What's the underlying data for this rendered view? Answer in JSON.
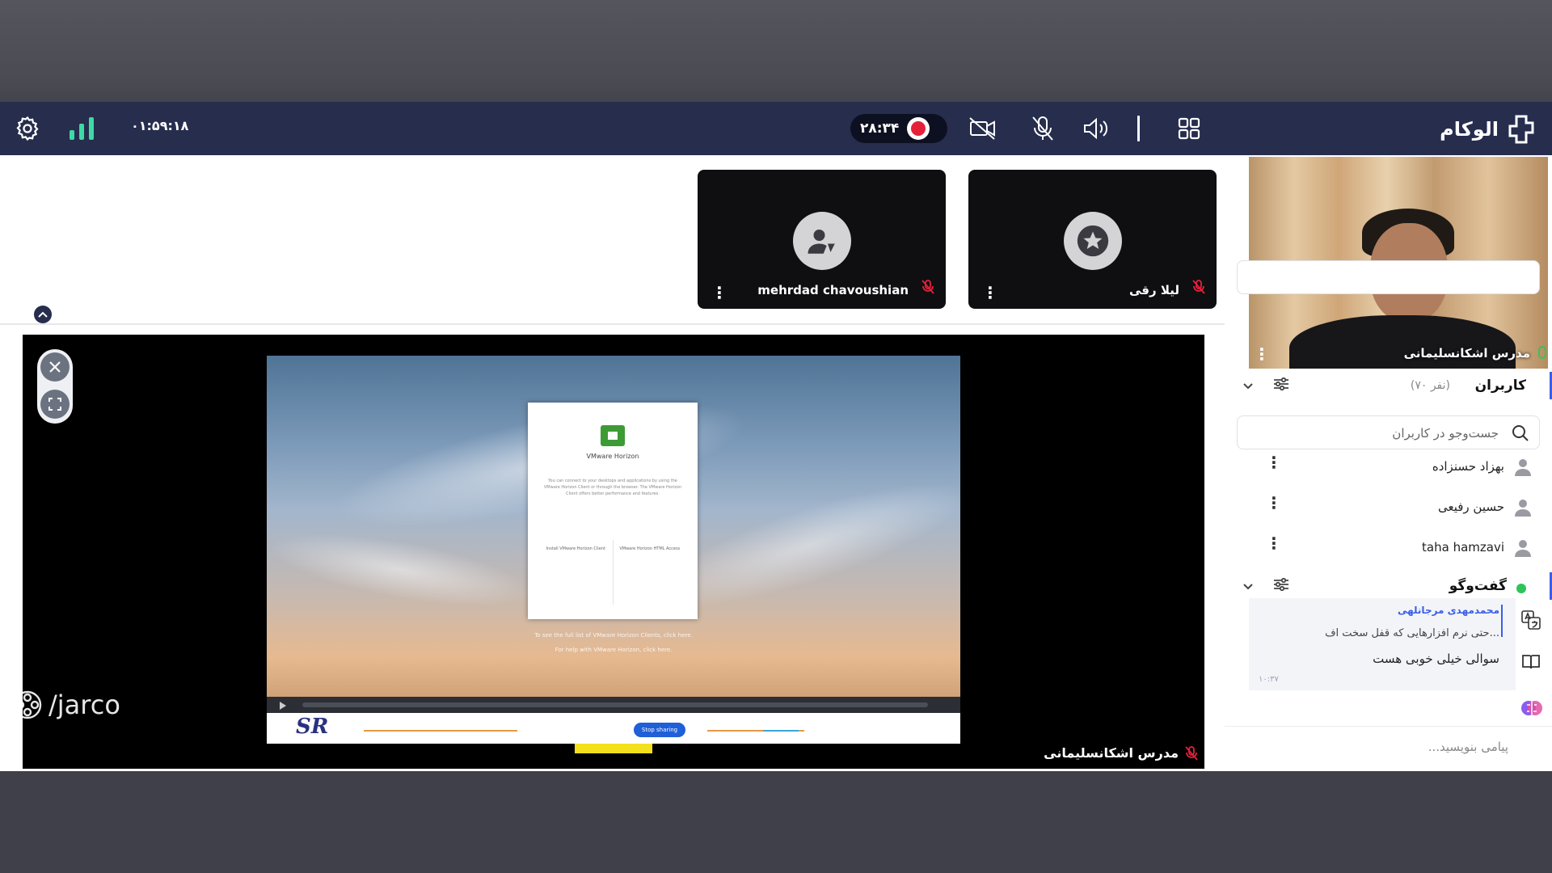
{
  "topbar": {
    "elapsed_time": "۰۱:۵۹:۱۸",
    "recording_timer": "۲۸:۳۴",
    "brand_name": "الوکام"
  },
  "thumbnails": [
    {
      "name": "mehrdad chavoushian"
    },
    {
      "name": "لیلا رقی"
    }
  ],
  "share": {
    "dialog_title": "VMware Horizon",
    "dialog_text": "You can connect to your desktops and applications by using the VMware Horizon Client or through the browser. The VMware Horizon Client offers better performance and features.",
    "option_install": "Install VMware Horizon Client",
    "option_browser": "VMware Horizon HTML Access",
    "caption_1": "To see the full list of VMware Horizon Clients, click here.",
    "caption_2": "For help with VMware Horizon, click here.",
    "stop_sharing": "Stop sharing",
    "sr_logo": "SR",
    "presenter": "مدرس اشکانسلیمانی"
  },
  "watermark": "/jarco",
  "camera": {
    "name": "مدرس اشکانسلیمانی"
  },
  "users": {
    "title": "کاربران",
    "count": "(۷۰ نفر)",
    "search_placeholder": "جست‌وجو در کاربران",
    "list": [
      {
        "name": "بهزاد حسنزاده"
      },
      {
        "name": "حسین رفیعی"
      },
      {
        "name": "taha hamzavi"
      }
    ]
  },
  "chat": {
    "title": "گفت‌وگو",
    "sender": "محمدمهدی مرجانلهی",
    "message_1": "حتی نرم افزارهایی که قفل سخت اف...",
    "message_2": "سوالی خیلی خوبی هست",
    "time": "۱۰:۳۷",
    "input_placeholder": "...پیامی بنویسید"
  },
  "colors": {
    "topbar": "#262d4d",
    "record": "#e5213a",
    "accent": "#3a5ee8",
    "online": "#2fc35b"
  }
}
